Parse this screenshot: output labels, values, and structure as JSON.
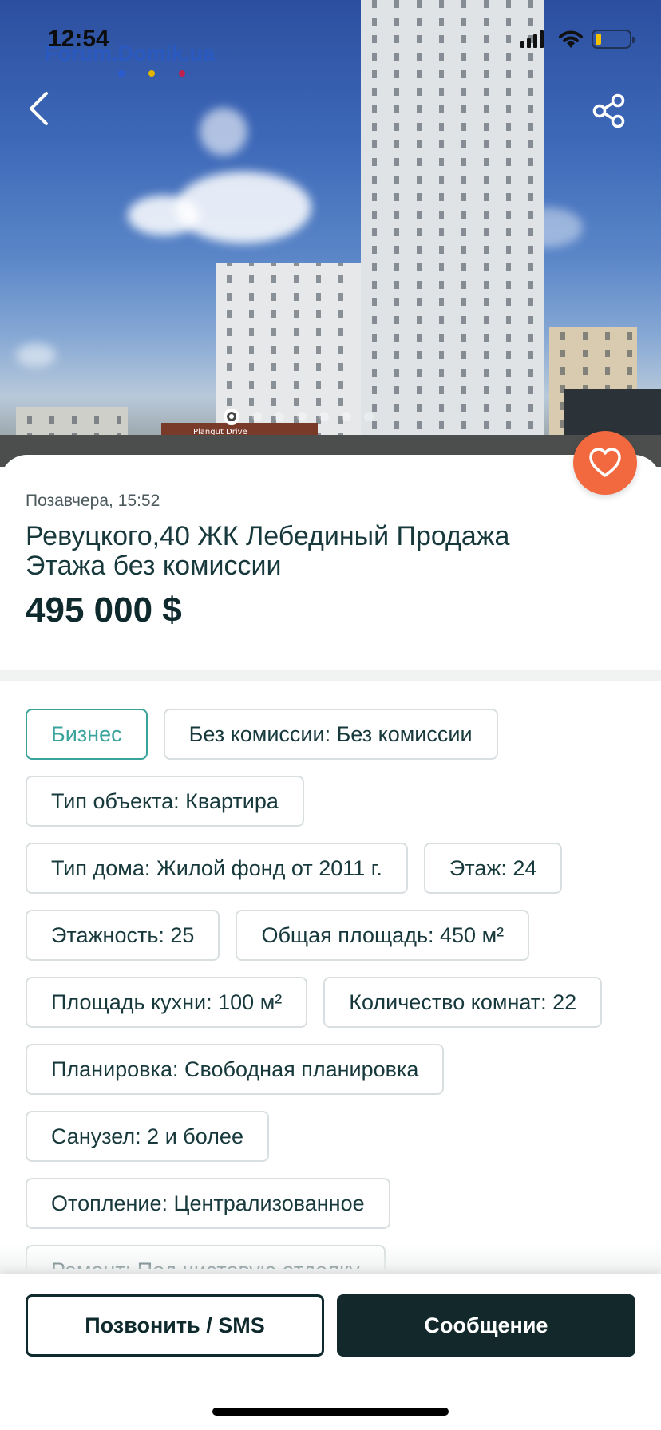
{
  "status_bar": {
    "time": "12:54",
    "watermark": "Forum.Domik.ua"
  },
  "hero": {
    "shop_sign": "Plangut Drive",
    "photo_count": 7,
    "active_photo": 1
  },
  "listing": {
    "date": "Позавчера, 15:52",
    "title": "Ревуцкого,40 ЖК Лебединый Продажа Этажа без комиссии",
    "price": "495 000 $"
  },
  "chips": [
    [
      "Бизнес",
      "Без комиссии: Без комиссии"
    ],
    [
      "Тип объекта: Квартира"
    ],
    [
      "Тип дома: Жилой фонд от 2011 г.",
      "Этаж: 24"
    ],
    [
      "Этажность: 25",
      "Общая площадь: 450 м²"
    ],
    [
      "Площадь кухни: 100 м²",
      "Количество комнат: 22"
    ],
    [
      "Планировка: Свободная планировка"
    ],
    [
      "Санузел: 2 и более"
    ],
    [
      "Отопление: Централизованное"
    ],
    [
      "Ремонт: Под чистовую отделку"
    ]
  ],
  "actions": {
    "call_label": "Позвонить / SMS",
    "message_label": "Сообщение"
  },
  "colors": {
    "accent": "#3aa39b",
    "favorite": "#f2683f",
    "primary_dark": "#12282b",
    "battery_level": "#f2c200"
  },
  "icons": {
    "back": "chevron-left-icon",
    "share": "share-icon",
    "favorite": "heart-icon"
  }
}
